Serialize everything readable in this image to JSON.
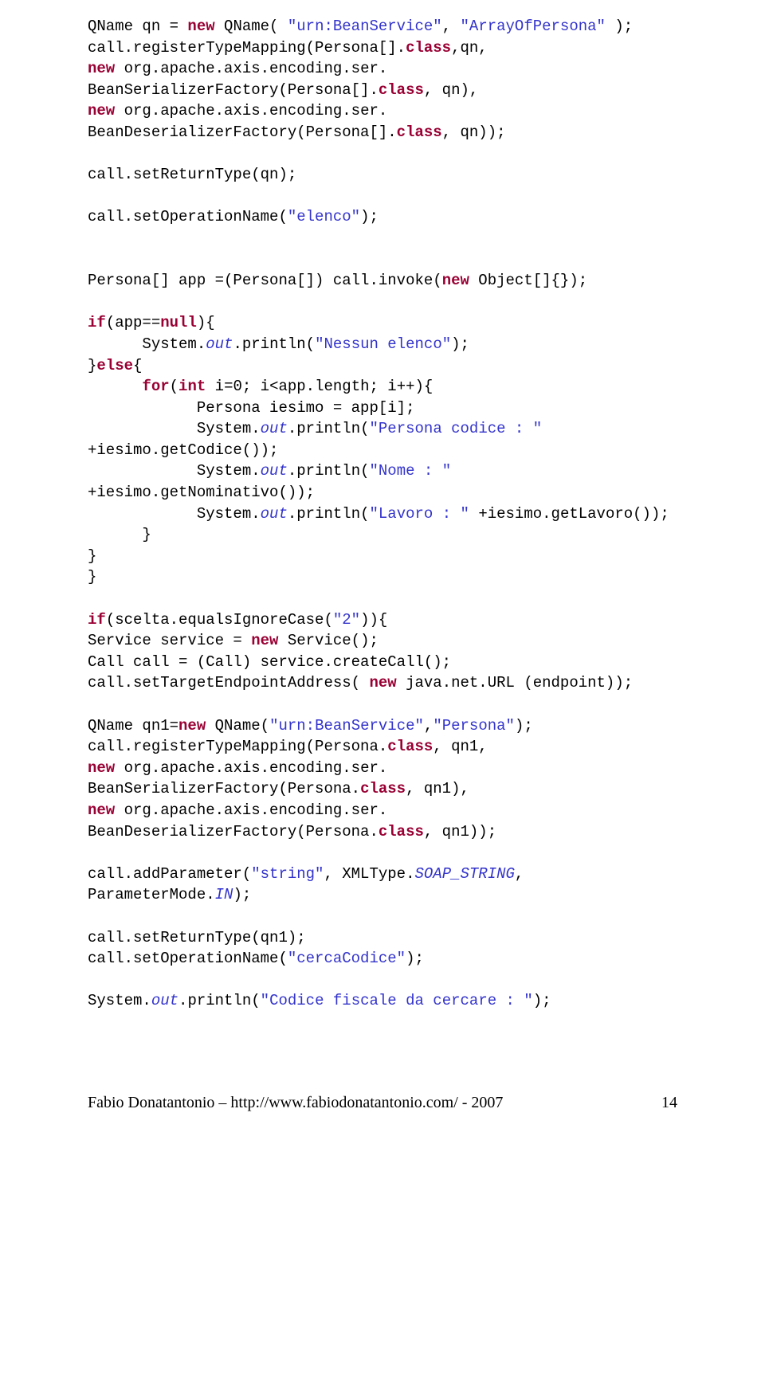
{
  "colors": {
    "keyword": "#990033",
    "string": "#3333cc",
    "plain": "#000000"
  },
  "code": {
    "l1": [
      {
        "t": "QName qn = ",
        "c": "plain"
      },
      {
        "t": "new",
        "c": "kw"
      },
      {
        "t": " QName( ",
        "c": "plain"
      },
      {
        "t": "\"urn:BeanService\"",
        "c": "str"
      },
      {
        "t": ", ",
        "c": "plain"
      },
      {
        "t": "\"ArrayOfPersona\"",
        "c": "str"
      },
      {
        "t": " );",
        "c": "plain"
      }
    ],
    "l2": [
      {
        "t": "call.registerTypeMapping(Persona[].",
        "c": "plain"
      },
      {
        "t": "class",
        "c": "kw"
      },
      {
        "t": ",qn,",
        "c": "plain"
      }
    ],
    "l3": [
      {
        "t": "new",
        "c": "kw"
      },
      {
        "t": " org.apache.axis.encoding.ser.",
        "c": "plain"
      }
    ],
    "l4": [
      {
        "t": "BeanSerializerFactory(Persona[].",
        "c": "plain"
      },
      {
        "t": "class",
        "c": "kw"
      },
      {
        "t": ", qn),",
        "c": "plain"
      }
    ],
    "l5": [
      {
        "t": "new",
        "c": "kw"
      },
      {
        "t": " org.apache.axis.encoding.ser.",
        "c": "plain"
      }
    ],
    "l6": [
      {
        "t": "BeanDeserializerFactory(Persona[].",
        "c": "plain"
      },
      {
        "t": "class",
        "c": "kw"
      },
      {
        "t": ", qn));",
        "c": "plain"
      }
    ],
    "l7": [
      {
        "t": "call.setReturnType(qn);",
        "c": "plain"
      }
    ],
    "l8": [
      {
        "t": "call.setOperationName(",
        "c": "plain"
      },
      {
        "t": "\"elenco\"",
        "c": "str"
      },
      {
        "t": ");",
        "c": "plain"
      }
    ],
    "l9": [
      {
        "t": "Persona[] app =(Persona[]) call.invoke(",
        "c": "plain"
      },
      {
        "t": "new",
        "c": "kw"
      },
      {
        "t": " Object[]{});",
        "c": "plain"
      }
    ],
    "l10": [
      {
        "t": "if",
        "c": "kw"
      },
      {
        "t": "(app==",
        "c": "plain"
      },
      {
        "t": "null",
        "c": "kw"
      },
      {
        "t": "){",
        "c": "plain"
      }
    ],
    "l11": [
      {
        "t": "      System.",
        "c": "plain"
      },
      {
        "t": "out",
        "c": "ital"
      },
      {
        "t": ".println(",
        "c": "plain"
      },
      {
        "t": "\"Nessun elenco\"",
        "c": "str"
      },
      {
        "t": ");",
        "c": "plain"
      }
    ],
    "l12": [
      {
        "t": "}",
        "c": "plain"
      },
      {
        "t": "else",
        "c": "kw"
      },
      {
        "t": "{",
        "c": "plain"
      }
    ],
    "l13": [
      {
        "t": "      ",
        "c": "plain"
      },
      {
        "t": "for",
        "c": "kw"
      },
      {
        "t": "(",
        "c": "plain"
      },
      {
        "t": "int",
        "c": "kw"
      },
      {
        "t": " i=0; i<app.length; i++){",
        "c": "plain"
      }
    ],
    "l14": [
      {
        "t": "            Persona iesimo = app[i];",
        "c": "plain"
      }
    ],
    "l15": [
      {
        "t": "            System.",
        "c": "plain"
      },
      {
        "t": "out",
        "c": "ital"
      },
      {
        "t": ".println(",
        "c": "plain"
      },
      {
        "t": "\"Persona codice : \"",
        "c": "str"
      },
      {
        "t": " +iesimo.getCodice());",
        "c": "plain"
      }
    ],
    "l16": [
      {
        "t": "            System.",
        "c": "plain"
      },
      {
        "t": "out",
        "c": "ital"
      },
      {
        "t": ".println(",
        "c": "plain"
      },
      {
        "t": "\"Nome : \"",
        "c": "str"
      },
      {
        "t": " +iesimo.getNominativo());",
        "c": "plain"
      }
    ],
    "l17": [
      {
        "t": "            System.",
        "c": "plain"
      },
      {
        "t": "out",
        "c": "ital"
      },
      {
        "t": ".println(",
        "c": "plain"
      },
      {
        "t": "\"Lavoro : \"",
        "c": "str"
      },
      {
        "t": " +iesimo.getLavoro());",
        "c": "plain"
      }
    ],
    "l18": [
      {
        "t": "      }",
        "c": "plain"
      }
    ],
    "l19": [
      {
        "t": "}",
        "c": "plain"
      }
    ],
    "l20": [
      {
        "t": "}",
        "c": "plain"
      }
    ],
    "l21": [
      {
        "t": "if",
        "c": "kw"
      },
      {
        "t": "(scelta.equalsIgnoreCase(",
        "c": "plain"
      },
      {
        "t": "\"2\"",
        "c": "str"
      },
      {
        "t": ")){",
        "c": "plain"
      }
    ],
    "l22": [
      {
        "t": "Service service = ",
        "c": "plain"
      },
      {
        "t": "new",
        "c": "kw"
      },
      {
        "t": " Service();",
        "c": "plain"
      }
    ],
    "l23": [
      {
        "t": "Call call = (Call) service.createCall();",
        "c": "plain"
      }
    ],
    "l24": [
      {
        "t": "call.setTargetEndpointAddress( ",
        "c": "plain"
      },
      {
        "t": "new",
        "c": "kw"
      },
      {
        "t": " java.net.URL (endpoint));",
        "c": "plain"
      }
    ],
    "l25": [
      {
        "t": "QName qn1=",
        "c": "plain"
      },
      {
        "t": "new",
        "c": "kw"
      },
      {
        "t": " QName(",
        "c": "plain"
      },
      {
        "t": "\"urn:BeanService\"",
        "c": "str"
      },
      {
        "t": ",",
        "c": "plain"
      },
      {
        "t": "\"Persona\"",
        "c": "str"
      },
      {
        "t": ");",
        "c": "plain"
      }
    ],
    "l26": [
      {
        "t": "call.registerTypeMapping(Persona.",
        "c": "plain"
      },
      {
        "t": "class",
        "c": "kw"
      },
      {
        "t": ", qn1,",
        "c": "plain"
      }
    ],
    "l27": [
      {
        "t": "new",
        "c": "kw"
      },
      {
        "t": " org.apache.axis.encoding.ser.",
        "c": "plain"
      }
    ],
    "l28": [
      {
        "t": "BeanSerializerFactory(Persona.",
        "c": "plain"
      },
      {
        "t": "class",
        "c": "kw"
      },
      {
        "t": ", qn1),",
        "c": "plain"
      }
    ],
    "l29": [
      {
        "t": "new",
        "c": "kw"
      },
      {
        "t": " org.apache.axis.encoding.ser.",
        "c": "plain"
      }
    ],
    "l30": [
      {
        "t": "BeanDeserializerFactory(Persona.",
        "c": "plain"
      },
      {
        "t": "class",
        "c": "kw"
      },
      {
        "t": ", qn1));",
        "c": "plain"
      }
    ],
    "l31": [
      {
        "t": "call.addParameter(",
        "c": "plain"
      },
      {
        "t": "\"string\"",
        "c": "str"
      },
      {
        "t": ", XMLType.",
        "c": "plain"
      },
      {
        "t": "SOAP_STRING",
        "c": "ital"
      },
      {
        "t": ", ParameterMode.",
        "c": "plain"
      },
      {
        "t": "IN",
        "c": "ital"
      },
      {
        "t": ");",
        "c": "plain"
      }
    ],
    "l32": [
      {
        "t": "call.setReturnType(qn1);",
        "c": "plain"
      }
    ],
    "l33": [
      {
        "t": "call.setOperationName(",
        "c": "plain"
      },
      {
        "t": "\"cercaCodice\"",
        "c": "str"
      },
      {
        "t": ");",
        "c": "plain"
      }
    ],
    "l34": [
      {
        "t": "System.",
        "c": "plain"
      },
      {
        "t": "out",
        "c": "ital"
      },
      {
        "t": ".println(",
        "c": "plain"
      },
      {
        "t": "\"Codice fiscale da cercare : \"",
        "c": "str"
      },
      {
        "t": ");",
        "c": "plain"
      }
    ]
  },
  "footer": {
    "left": "Fabio Donatantonio – http://www.fabiodonatantonio.com/ - 2007",
    "right": "14"
  }
}
